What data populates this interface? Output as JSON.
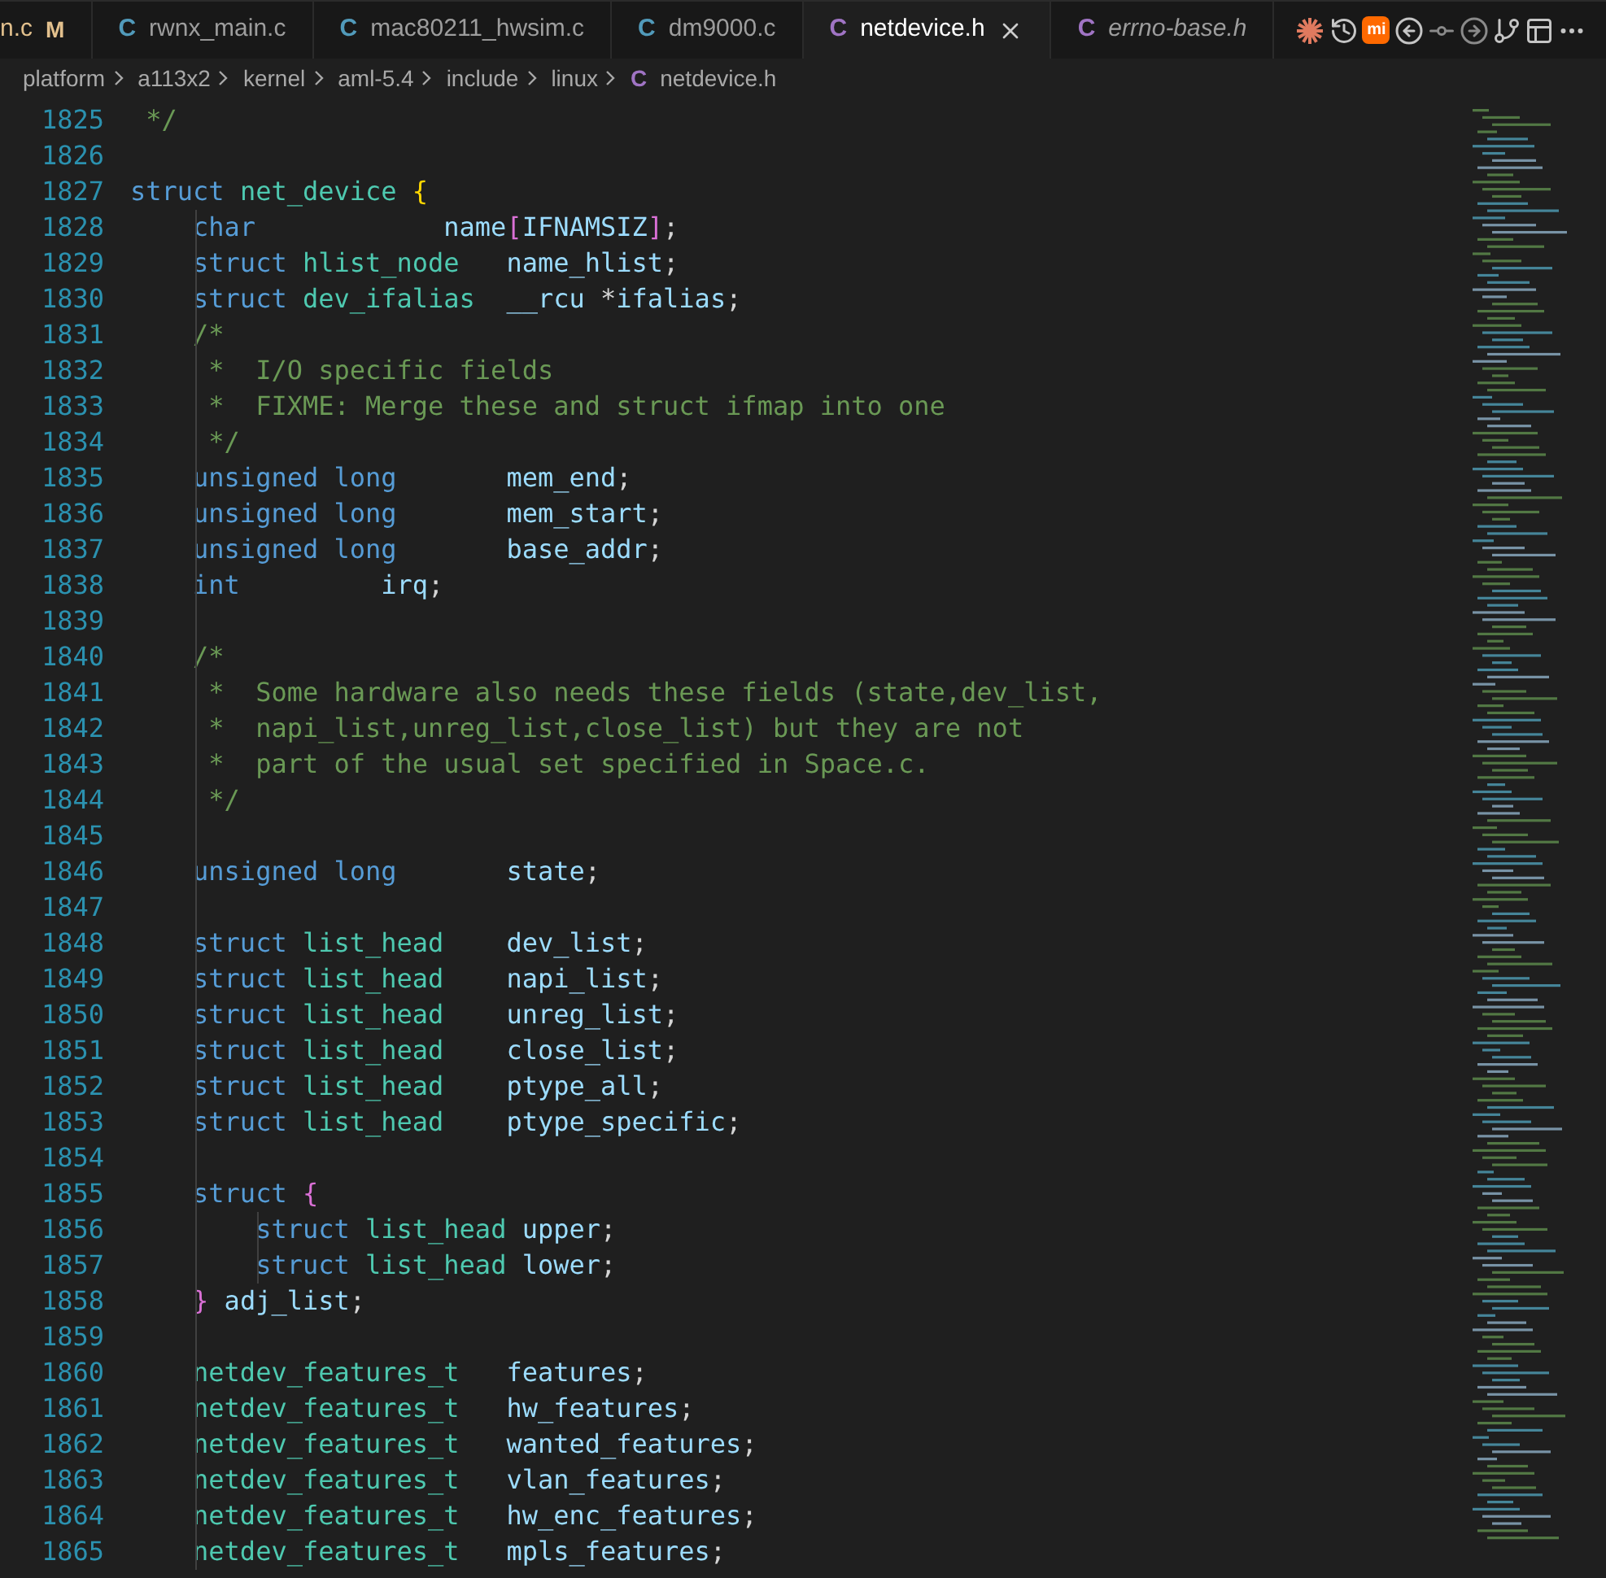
{
  "tabs": [
    {
      "label": "n.c",
      "badge": "M",
      "selected": false,
      "preview": false
    },
    {
      "label": "rwnx_main.c",
      "icon": "C",
      "color": "#519aba",
      "selected": false,
      "preview": false
    },
    {
      "label": "mac80211_hwsim.c",
      "icon": "C",
      "color": "#519aba",
      "selected": false,
      "preview": false
    },
    {
      "label": "dm9000.c",
      "icon": "C",
      "color": "#519aba",
      "selected": false,
      "preview": false
    },
    {
      "label": "netdevice.h",
      "icon": "C",
      "color": "#a074c4",
      "selected": true,
      "preview": false
    },
    {
      "label": "errno-base.h",
      "icon": "C",
      "color": "#a074c4",
      "selected": false,
      "preview": true
    }
  ],
  "actions": [
    {
      "kind": "spark"
    },
    {
      "kind": "history"
    },
    {
      "kind": "mi",
      "label": "mi"
    },
    {
      "kind": "source"
    },
    {
      "kind": "previous"
    },
    {
      "kind": "next"
    },
    {
      "kind": "graph"
    },
    {
      "kind": "split"
    },
    {
      "kind": "more"
    }
  ],
  "breadcrumb": [
    {
      "label": "platform"
    },
    {
      "label": "a113x2"
    },
    {
      "label": "kernel"
    },
    {
      "label": "aml-5.4"
    },
    {
      "label": "include"
    },
    {
      "label": "linux"
    },
    {
      "label": "netdevice.h",
      "icon": "C"
    }
  ],
  "lines": [
    {
      "number": "1825",
      "tokens": [
        {
          "kind": "comment",
          "text": " */"
        }
      ]
    },
    {
      "number": "1826"
    },
    {
      "number": "1827",
      "tokens": [
        {
          "kind": "keyword",
          "text": "struct "
        },
        {
          "kind": "type",
          "text": "net_device "
        },
        {
          "kind": "brace",
          "text": "{"
        }
      ]
    },
    {
      "number": "1828",
      "tokens": [
        {
          "kind": "keyword",
          "text": "    char"
        },
        {
          "kind": "var",
          "text": "            name"
        },
        {
          "kind": "bracket",
          "text": "["
        },
        {
          "kind": "var",
          "text": "IFNAMSIZ"
        },
        {
          "kind": "bracket",
          "text": "]"
        },
        {
          "kind": "plain",
          "text": ";"
        }
      ]
    },
    {
      "number": "1829",
      "tokens": [
        {
          "kind": "keyword",
          "text": "    struct "
        },
        {
          "kind": "type",
          "text": "hlist_node"
        },
        {
          "kind": "var",
          "text": "   name_hlist"
        },
        {
          "kind": "plain",
          "text": ";"
        }
      ]
    },
    {
      "number": "1830",
      "tokens": [
        {
          "kind": "keyword",
          "text": "    struct "
        },
        {
          "kind": "type",
          "text": "dev_ifalias"
        },
        {
          "kind": "var",
          "text": "  __rcu "
        },
        {
          "kind": "plain",
          "text": "*"
        },
        {
          "kind": "var",
          "text": "ifalias"
        },
        {
          "kind": "plain",
          "text": ";"
        }
      ]
    },
    {
      "number": "1831",
      "tokens": [
        {
          "kind": "comment",
          "text": "    /*"
        }
      ]
    },
    {
      "number": "1832",
      "tokens": [
        {
          "kind": "comment",
          "text": "     *  I/O specific fields"
        }
      ]
    },
    {
      "number": "1833",
      "tokens": [
        {
          "kind": "comment",
          "text": "     *  FIXME: Merge these and struct ifmap into one"
        }
      ]
    },
    {
      "number": "1834",
      "tokens": [
        {
          "kind": "comment",
          "text": "     */"
        }
      ]
    },
    {
      "number": "1835",
      "tokens": [
        {
          "kind": "keyword",
          "text": "    unsigned long"
        },
        {
          "kind": "var",
          "text": "       mem_end"
        },
        {
          "kind": "plain",
          "text": ";"
        }
      ]
    },
    {
      "number": "1836",
      "tokens": [
        {
          "kind": "keyword",
          "text": "    unsigned long"
        },
        {
          "kind": "var",
          "text": "       mem_start"
        },
        {
          "kind": "plain",
          "text": ";"
        }
      ]
    },
    {
      "number": "1837",
      "tokens": [
        {
          "kind": "keyword",
          "text": "    unsigned long"
        },
        {
          "kind": "var",
          "text": "       base_addr"
        },
        {
          "kind": "plain",
          "text": ";"
        }
      ]
    },
    {
      "number": "1838",
      "tokens": [
        {
          "kind": "keyword",
          "text": "    int"
        },
        {
          "kind": "var",
          "text": "         irq"
        },
        {
          "kind": "plain",
          "text": ";"
        }
      ]
    },
    {
      "number": "1839"
    },
    {
      "number": "1840",
      "tokens": [
        {
          "kind": "comment",
          "text": "    /*"
        }
      ]
    },
    {
      "number": "1841",
      "tokens": [
        {
          "kind": "comment",
          "text": "     *  Some hardware also needs these fields (state,dev_list,"
        }
      ]
    },
    {
      "number": "1842",
      "tokens": [
        {
          "kind": "comment",
          "text": "     *  napi_list,unreg_list,close_list) but they are not"
        }
      ]
    },
    {
      "number": "1843",
      "tokens": [
        {
          "kind": "comment",
          "text": "     *  part of the usual set specified in Space.c."
        }
      ]
    },
    {
      "number": "1844",
      "tokens": [
        {
          "kind": "comment",
          "text": "     */"
        }
      ]
    },
    {
      "number": "1845"
    },
    {
      "number": "1846",
      "tokens": [
        {
          "kind": "keyword",
          "text": "    unsigned long"
        },
        {
          "kind": "var",
          "text": "       state"
        },
        {
          "kind": "plain",
          "text": ";"
        }
      ]
    },
    {
      "number": "1847"
    },
    {
      "number": "1848",
      "tokens": [
        {
          "kind": "keyword",
          "text": "    struct "
        },
        {
          "kind": "type",
          "text": "list_head"
        },
        {
          "kind": "var",
          "text": "    dev_list"
        },
        {
          "kind": "plain",
          "text": ";"
        }
      ]
    },
    {
      "number": "1849",
      "tokens": [
        {
          "kind": "keyword",
          "text": "    struct "
        },
        {
          "kind": "type",
          "text": "list_head"
        },
        {
          "kind": "var",
          "text": "    napi_list"
        },
        {
          "kind": "plain",
          "text": ";"
        }
      ]
    },
    {
      "number": "1850",
      "tokens": [
        {
          "kind": "keyword",
          "text": "    struct "
        },
        {
          "kind": "type",
          "text": "list_head"
        },
        {
          "kind": "var",
          "text": "    unreg_list"
        },
        {
          "kind": "plain",
          "text": ";"
        }
      ]
    },
    {
      "number": "1851",
      "tokens": [
        {
          "kind": "keyword",
          "text": "    struct "
        },
        {
          "kind": "type",
          "text": "list_head"
        },
        {
          "kind": "var",
          "text": "    close_list"
        },
        {
          "kind": "plain",
          "text": ";"
        }
      ]
    },
    {
      "number": "1852",
      "tokens": [
        {
          "kind": "keyword",
          "text": "    struct "
        },
        {
          "kind": "type",
          "text": "list_head"
        },
        {
          "kind": "var",
          "text": "    ptype_all"
        },
        {
          "kind": "plain",
          "text": ";"
        }
      ]
    },
    {
      "number": "1853",
      "tokens": [
        {
          "kind": "keyword",
          "text": "    struct "
        },
        {
          "kind": "type",
          "text": "list_head"
        },
        {
          "kind": "var",
          "text": "    ptype_specific"
        },
        {
          "kind": "plain",
          "text": ";"
        }
      ]
    },
    {
      "number": "1854"
    },
    {
      "number": "1855",
      "tokens": [
        {
          "kind": "keyword",
          "text": "    struct "
        },
        {
          "kind": "bracket",
          "text": "{"
        }
      ]
    },
    {
      "number": "1856",
      "tokens": [
        {
          "kind": "keyword",
          "text": "        struct "
        },
        {
          "kind": "type",
          "text": "list_head "
        },
        {
          "kind": "var",
          "text": "upper"
        },
        {
          "kind": "plain",
          "text": ";"
        }
      ]
    },
    {
      "number": "1857",
      "tokens": [
        {
          "kind": "keyword",
          "text": "        struct "
        },
        {
          "kind": "type",
          "text": "list_head "
        },
        {
          "kind": "var",
          "text": "lower"
        },
        {
          "kind": "plain",
          "text": ";"
        }
      ]
    },
    {
      "number": "1858",
      "tokens": [
        {
          "kind": "bracket",
          "text": "    }"
        },
        {
          "kind": "var",
          "text": " adj_list"
        },
        {
          "kind": "plain",
          "text": ";"
        }
      ]
    },
    {
      "number": "1859"
    },
    {
      "number": "1860",
      "tokens": [
        {
          "kind": "type",
          "text": "    netdev_features_t"
        },
        {
          "kind": "var",
          "text": "   features"
        },
        {
          "kind": "plain",
          "text": ";"
        }
      ]
    },
    {
      "number": "1861",
      "tokens": [
        {
          "kind": "type",
          "text": "    netdev_features_t"
        },
        {
          "kind": "var",
          "text": "   hw_features"
        },
        {
          "kind": "plain",
          "text": ";"
        }
      ]
    },
    {
      "number": "1862",
      "tokens": [
        {
          "kind": "type",
          "text": "    netdev_features_t"
        },
        {
          "kind": "var",
          "text": "   wanted_features"
        },
        {
          "kind": "plain",
          "text": ";"
        }
      ]
    },
    {
      "number": "1863",
      "tokens": [
        {
          "kind": "type",
          "text": "    netdev_features_t"
        },
        {
          "kind": "var",
          "text": "   vlan_features"
        },
        {
          "kind": "plain",
          "text": ";"
        }
      ]
    },
    {
      "number": "1864",
      "tokens": [
        {
          "kind": "type",
          "text": "    netdev_features_t"
        },
        {
          "kind": "var",
          "text": "   hw_enc_features"
        },
        {
          "kind": "plain",
          "text": ";"
        }
      ]
    },
    {
      "number": "1865",
      "tokens": [
        {
          "kind": "type",
          "text": "    netdev_features_t"
        },
        {
          "kind": "var",
          "text": "   mpls_features"
        },
        {
          "kind": "plain",
          "text": ";"
        }
      ]
    }
  ]
}
